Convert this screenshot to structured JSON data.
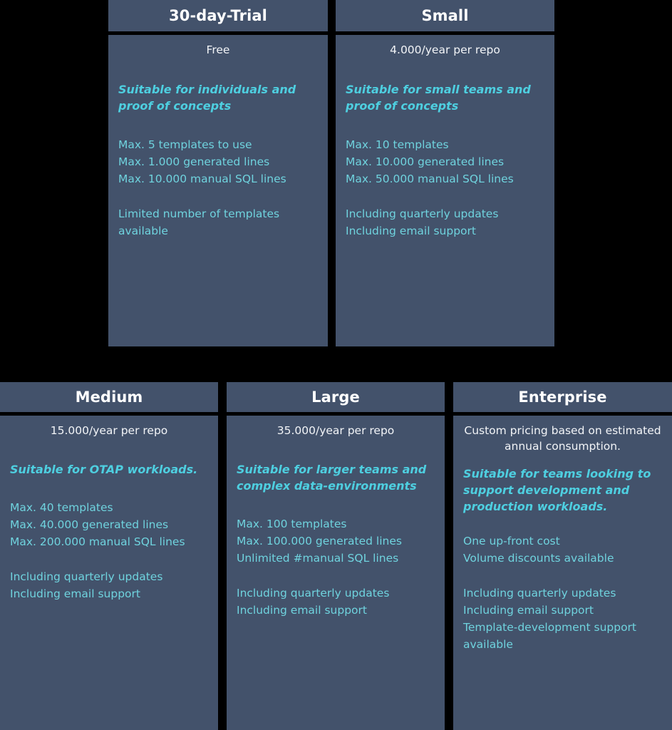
{
  "colors": {
    "background": "#000000",
    "card": "#43526b",
    "header_text": "#ffffff",
    "price_text": "#f2f4f7",
    "tagline_accent": "#4ecfe0",
    "feature_text": "#6fd3de"
  },
  "plans": {
    "trial": {
      "name": "30-day-Trial",
      "price": "Free",
      "tagline": "Suitable for individuals and\nproof of concepts",
      "limits": "Max. 5 templates to use\nMax. 1.000 generated lines\nMax. 10.000 manual SQL lines",
      "extras": "Limited number of templates\navailable"
    },
    "small": {
      "name": "Small",
      "price": "4.000/year per repo",
      "tagline": "Suitable for small teams and\nproof of concepts",
      "limits": "Max. 10 templates\nMax. 10.000 generated lines\nMax. 50.000 manual SQL lines",
      "extras": "Including quarterly updates\nIncluding email support"
    },
    "medium": {
      "name": "Medium",
      "price": "15.000/year per repo",
      "tagline": "Suitable for OTAP workloads.",
      "limits": "Max. 40 templates\nMax. 40.000 generated lines\nMax. 200.000 manual SQL lines",
      "extras": "Including quarterly updates\nIncluding email support"
    },
    "large": {
      "name": "Large",
      "price": "35.000/year per repo",
      "tagline": "Suitable for larger teams and\ncomplex data-environments",
      "limits": "Max. 100 templates\nMax. 100.000 generated lines\nUnlimited #manual SQL lines",
      "extras": "Including quarterly updates\nIncluding email support"
    },
    "enterprise": {
      "name": "Enterprise",
      "price": "Custom pricing based on estimated annual consumption.",
      "tagline": "Suitable for teams looking to\nsupport development and\nproduction workloads.",
      "limits": "One up-front cost\nVolume discounts available",
      "extras": "Including quarterly updates\nIncluding email support\nTemplate-development support\navailable"
    }
  }
}
